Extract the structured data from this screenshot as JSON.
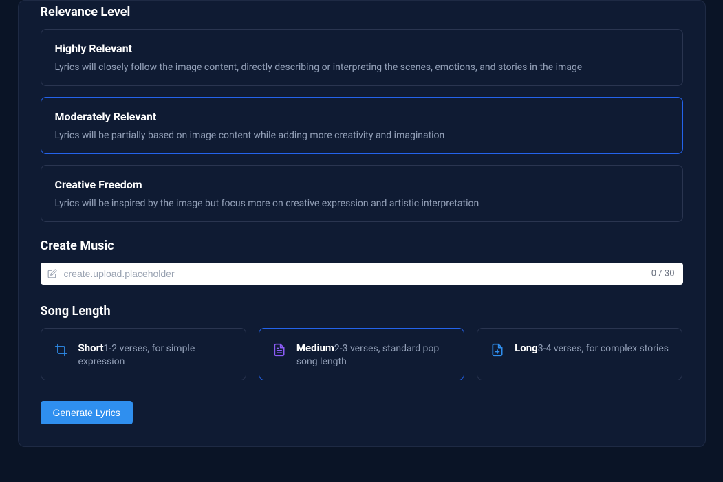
{
  "relevance": {
    "heading": "Relevance Level",
    "options": [
      {
        "title": "Highly Relevant",
        "desc": "Lyrics will closely follow the image content, directly describing or interpreting the scenes, emotions, and stories in the image"
      },
      {
        "title": "Moderately Relevant",
        "desc": "Lyrics will be partially based on image content while adding more creativity and imagination"
      },
      {
        "title": "Creative Freedom",
        "desc": "Lyrics will be inspired by the image but focus more on creative expression and artistic interpretation"
      }
    ]
  },
  "create_music": {
    "heading": "Create Music",
    "placeholder": "create.upload.placeholder",
    "counter": "0 / 30"
  },
  "song_length": {
    "heading": "Song Length",
    "options": [
      {
        "title": "Short",
        "desc": "1-2 verses, for simple expression"
      },
      {
        "title": "Medium",
        "desc": "2-3 verses, standard pop song length"
      },
      {
        "title": "Long",
        "desc": "3-4 verses, for complex stories"
      }
    ]
  },
  "generate_label": "Generate Lyrics"
}
